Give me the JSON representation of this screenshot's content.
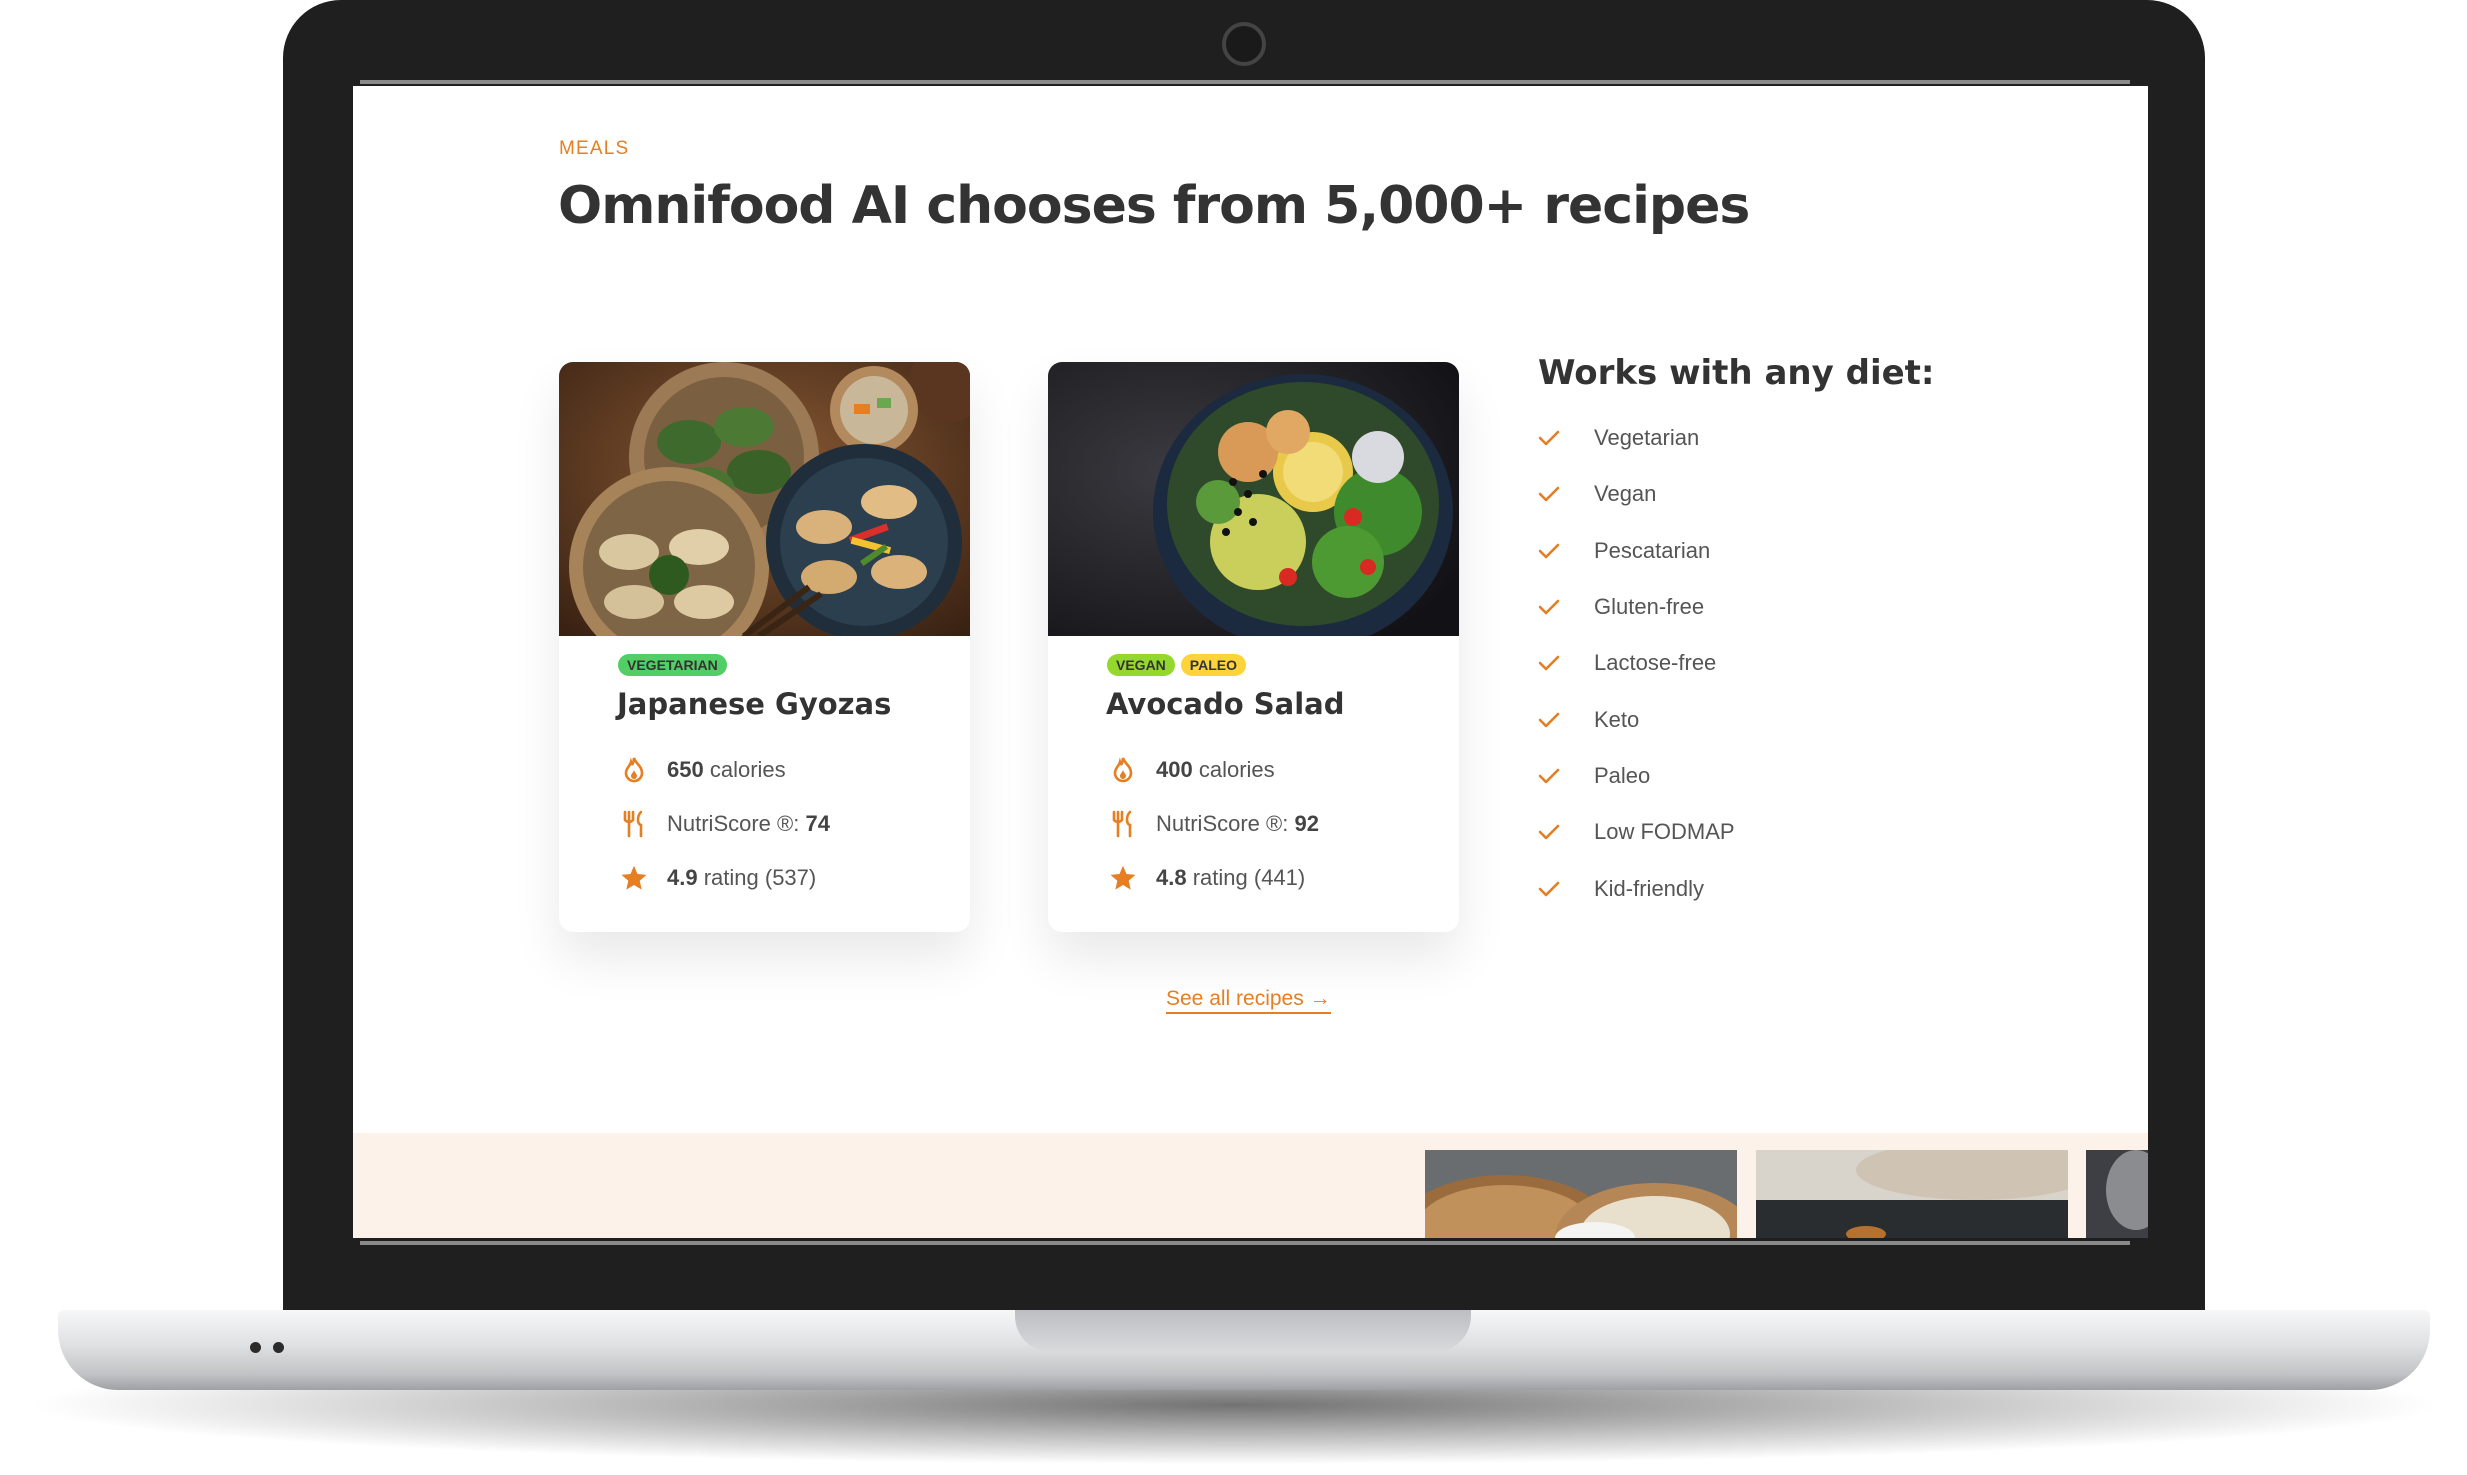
{
  "meals": {
    "subheading": "MEALS",
    "heading": "Omnifood AI chooses from 5,000+ recipes",
    "cards": [
      {
        "tags": [
          "VEGETARIAN"
        ],
        "title": "Japanese Gyozas",
        "calories_value": "650",
        "calories_label": "calories",
        "nutri_label": "NutriScore ®:",
        "nutri_value": "74",
        "rating_value": "4.9",
        "rating_label": "rating (537)",
        "photo_icon": "gyoza-plates-photo"
      },
      {
        "tags": [
          "VEGAN",
          "PALEO"
        ],
        "title": "Avocado Salad",
        "calories_value": "400",
        "calories_label": "calories",
        "nutri_label": "NutriScore ®:",
        "nutri_value": "92",
        "rating_value": "4.8",
        "rating_label": "rating (441)",
        "photo_icon": "salad-bowl-photo"
      }
    ],
    "diets": {
      "title": "Works with any diet:",
      "items": [
        "Vegetarian",
        "Vegan",
        "Pescatarian",
        "Gluten-free",
        "Lactose-free",
        "Keto",
        "Paleo",
        "Low FODMAP",
        "Kid-friendly"
      ]
    },
    "see_all": "See all recipes →"
  },
  "colors": {
    "accent": "#e67e22",
    "text": "#333333",
    "tag_vegetarian": "#51cf66",
    "tag_vegan": "#94d82d",
    "tag_paleo": "#ffd43b",
    "section_bg": "#fdf2e9"
  },
  "icons": {
    "calories": "flame-icon",
    "nutriscore": "fork-knife-icon",
    "rating": "star-icon",
    "diet_item": "checkmark-icon"
  }
}
